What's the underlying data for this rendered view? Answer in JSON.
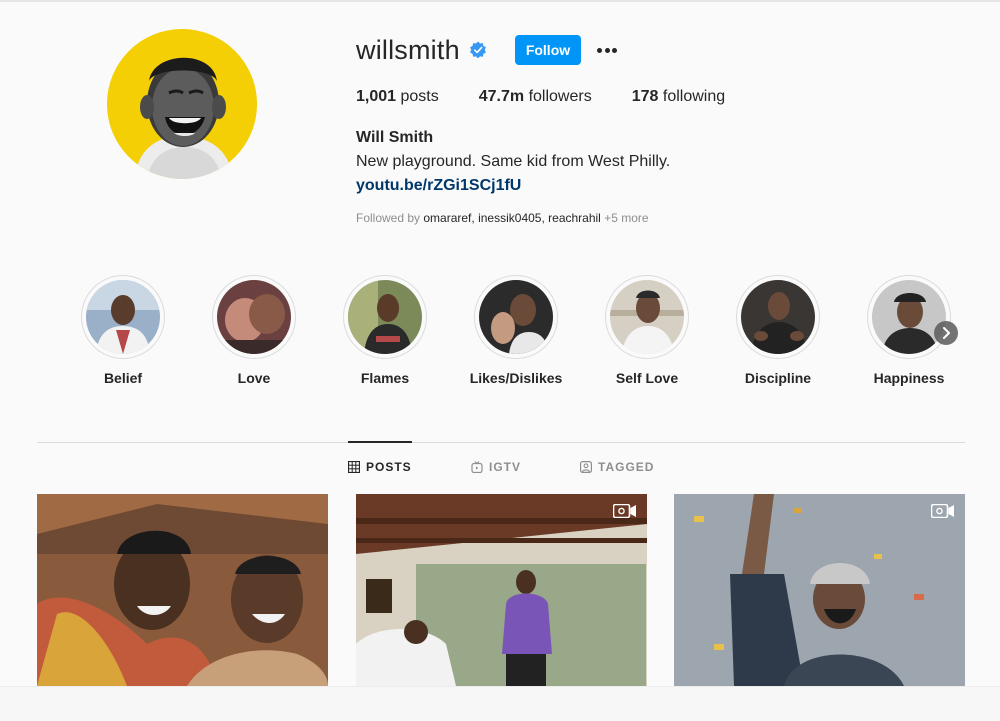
{
  "profile": {
    "username": "willsmith",
    "verified": true,
    "follow_label": "Follow",
    "posts_count": "1,001",
    "posts_label": "posts",
    "followers_count": "47.7m",
    "followers_label": "followers",
    "following_count": "178",
    "following_label": "following",
    "full_name": "Will Smith",
    "bio": "New playground. Same kid from West Philly.",
    "link": "youtu.be/rZGi1SCj1fU",
    "followed_by_prefix": "Followed by",
    "followed_by_users": [
      "omararef",
      "inessik0405",
      "reachrahil"
    ],
    "followed_by_more": "+5 more"
  },
  "highlights": [
    {
      "label": "Belief"
    },
    {
      "label": "Love"
    },
    {
      "label": "Flames"
    },
    {
      "label": "Likes/Dislikes"
    },
    {
      "label": "Self Love"
    },
    {
      "label": "Discipline"
    },
    {
      "label": "Happiness"
    }
  ],
  "tabs": [
    {
      "label": "POSTS",
      "icon": "grid-icon",
      "active": true
    },
    {
      "label": "IGTV",
      "icon": "igtv-icon",
      "active": false
    },
    {
      "label": "TAGGED",
      "icon": "tagged-icon",
      "active": false
    }
  ],
  "posts": [
    {
      "type": "photo"
    },
    {
      "type": "video"
    },
    {
      "type": "video"
    }
  ],
  "colors": {
    "accent": "#0095f6",
    "verified": "#3897f0",
    "avatar_bg": "#f5cf05",
    "link": "#00376b"
  }
}
